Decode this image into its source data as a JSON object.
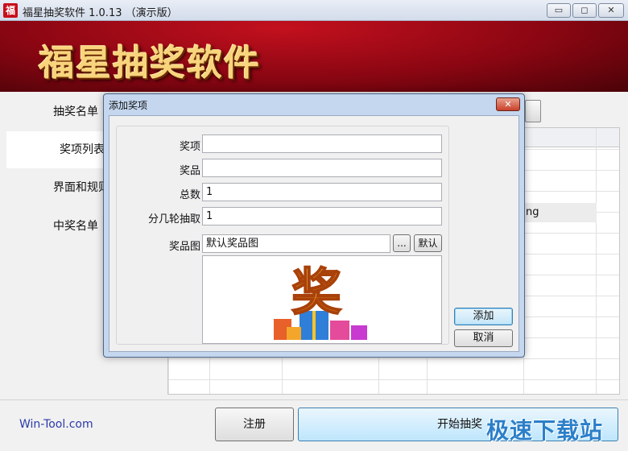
{
  "window": {
    "app_icon_glyph": "福",
    "title": "福星抽奖软件 1.0.13 （演示版）",
    "controls": {
      "minimize": "▭",
      "maximize": "◻",
      "close": "✕"
    }
  },
  "banner": {
    "title": "福星抽奖软件"
  },
  "sidebar": {
    "items": [
      {
        "label": "抽奖名单"
      },
      {
        "label": "奖项列表"
      },
      {
        "label": "界面和规则"
      },
      {
        "label": "中奖名单"
      }
    ]
  },
  "background_table": {
    "visible_cell": "ng"
  },
  "footer": {
    "link": "Win-Tool.com",
    "register_label": "注册",
    "start_label": "开始抽奖",
    "watermark": "极速下载站"
  },
  "dialog": {
    "title": "添加奖项",
    "close_glyph": "✕",
    "fields": {
      "prize_label": "奖项",
      "prize_value": "",
      "item_label": "奖品",
      "item_value": "",
      "total_label": "总数",
      "total_value": "1",
      "rounds_label": "分几轮抽取",
      "rounds_value": "1",
      "image_label": "奖品图",
      "image_value": "默认奖品图"
    },
    "browse_label": "...",
    "default_label": "默认",
    "preview_glyph": "奖",
    "add_label": "添加",
    "cancel_label": "取消"
  },
  "colors": {
    "banner_red": "#8a0612",
    "banner_text_gold": "#f8d47c",
    "dialog_frame": "#c4d7ef",
    "primary_button": "#bee6fd",
    "link_blue": "#2b3aa8",
    "watermark_blue": "#2c7fc9"
  }
}
